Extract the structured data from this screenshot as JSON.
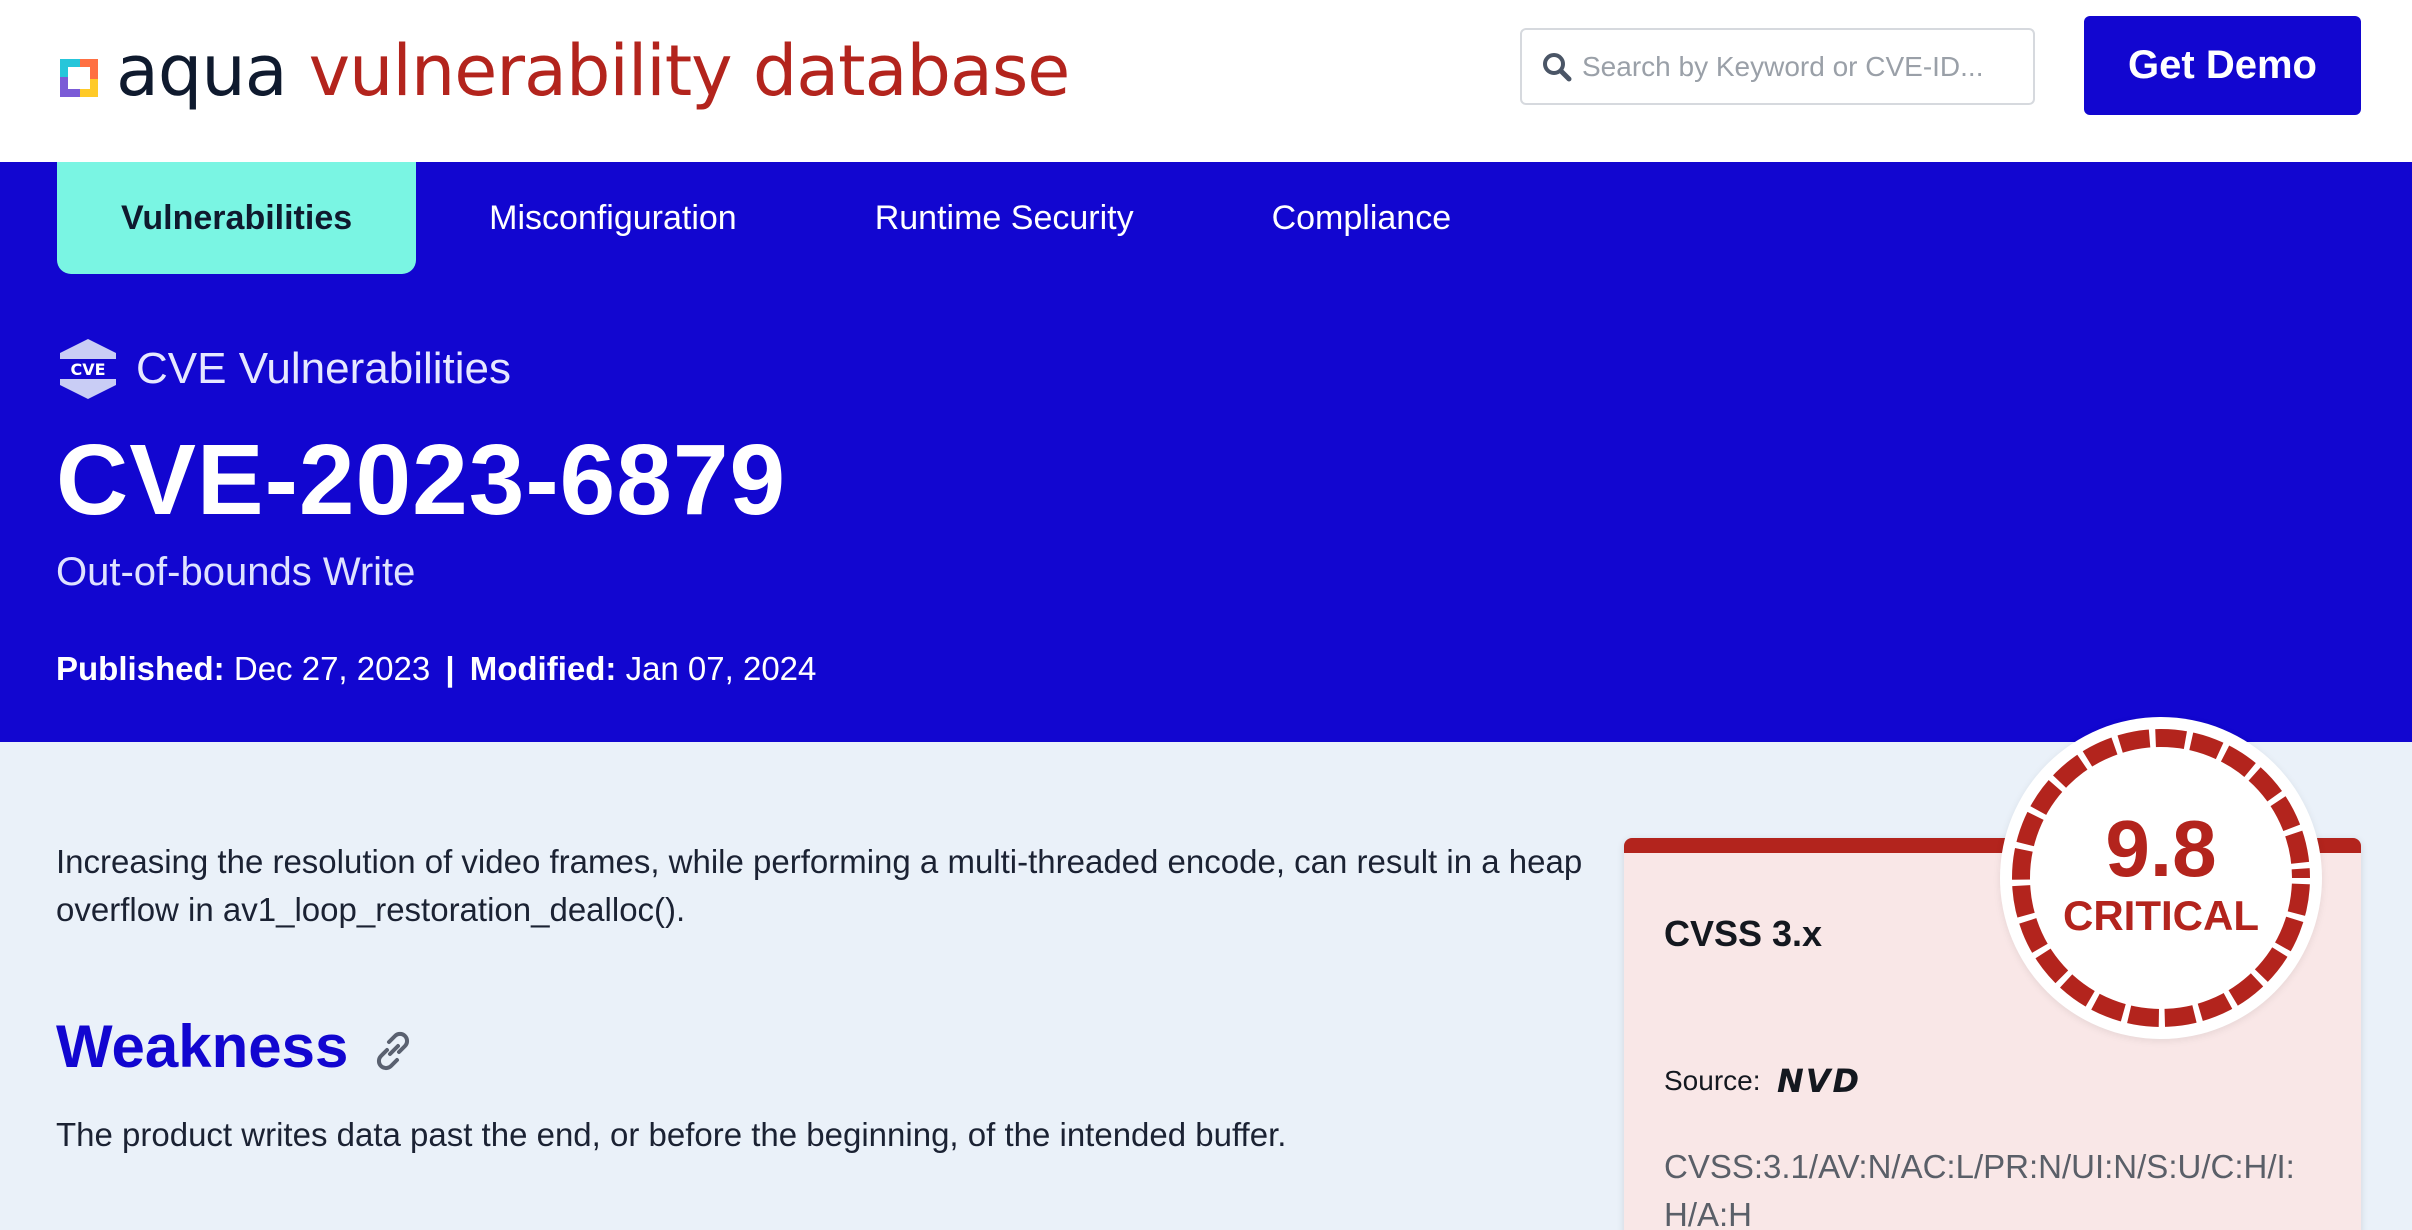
{
  "header": {
    "logo_word1": "aqua",
    "logo_word2": "vulnerability database",
    "search_placeholder": "Search by Keyword or CVE-ID...",
    "demo_label": "Get Demo"
  },
  "nav": {
    "tabs": [
      {
        "label": "Vulnerabilities",
        "active": true
      },
      {
        "label": "Misconfiguration",
        "active": false
      },
      {
        "label": "Runtime Security",
        "active": false
      },
      {
        "label": "Compliance",
        "active": false
      }
    ]
  },
  "hero": {
    "section": "CVE Vulnerabilities",
    "cve_id": "CVE-2023-6879",
    "cve_type": "Out-of-bounds Write",
    "published_label": "Published:",
    "published_date": "Dec 27, 2023",
    "separator": "|",
    "modified_label": "Modified:",
    "modified_date": "Jan 07, 2024"
  },
  "content": {
    "description": "Increasing the resolution of video frames, while performing a multi-threaded encode, can result in a heap overflow in av1_loop_restoration_dealloc().",
    "weakness_heading": "Weakness",
    "weakness_text": "The product writes data past the end, or before the beginning, of the intended buffer."
  },
  "cvss": {
    "title": "CVSS 3.x",
    "source_label": "Source:",
    "source_name": "NVD",
    "vector": "CVSS:3.1/AV:N/AC:L/PR:N/UI:N/S:U/C:H/I:H/A:H",
    "score": "9.8",
    "severity": "CRITICAL",
    "severity_color": "#b3241d"
  },
  "colors": {
    "brand_blue": "#1206d0",
    "active_tab": "#7af5e3",
    "critical_red": "#b3241d",
    "page_bg": "#eaf1f9"
  }
}
